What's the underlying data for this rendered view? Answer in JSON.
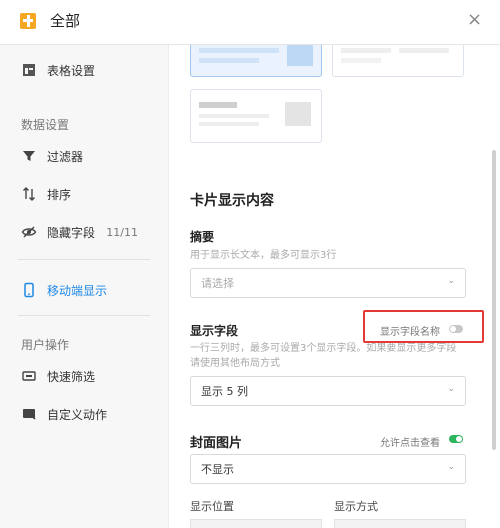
{
  "header": {
    "title": "全部",
    "close_icon": "×"
  },
  "sidebar": {
    "table_settings": "表格设置",
    "data_settings_heading": "数据设置",
    "filter": "过滤器",
    "sort": "排序",
    "hidden_fields": "隐藏字段",
    "hidden_fields_count": "11/11",
    "mobile_display": "移动端显示",
    "user_ops_heading": "用户操作",
    "quick_filter": "快速筛选",
    "custom_action": "自定义动作"
  },
  "main": {
    "card_section_title": "卡片显示内容",
    "summary": {
      "label": "摘要",
      "hint": "用于显示长文本，最多可显示3行",
      "placeholder": "请选择"
    },
    "display_fields": {
      "label": "显示字段",
      "toggle_label": "显示字段名称",
      "toggle_on": false,
      "hint": "一行三列时，最多可设置3个显示字段。如果要显示更多字段请使用其他布局方式",
      "value": "显示 5 列"
    },
    "cover_image": {
      "label": "封面图片",
      "toggle_label": "允许点击查看",
      "toggle_on": true,
      "value": "不显示"
    },
    "display_position_label": "显示位置",
    "display_mode_label": "显示方式"
  },
  "colors": {
    "accent": "#1e88e5",
    "toggle_on": "#2db55d",
    "highlight": "#e53935",
    "logo": "#f5a623"
  }
}
